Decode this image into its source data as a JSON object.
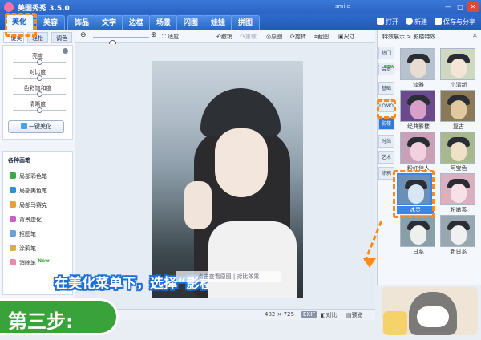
{
  "window": {
    "title": "美图秀秀 3.5.0",
    "user": "smile",
    "min": "—",
    "max": "□",
    "close": "✕"
  },
  "menu": {
    "tabs": [
      "美化",
      "美容",
      "饰品",
      "文字",
      "边框",
      "场景",
      "闪图",
      "娃娃",
      "拼图"
    ],
    "active": "美化",
    "open": "打开",
    "new": "新建",
    "save_share": "保存与分享"
  },
  "toolbar": {
    "fit": "适应",
    "undo": "撤销",
    "redo": "重做",
    "original": "原图",
    "rotate": "旋转",
    "crop": "截图",
    "size": "尺寸"
  },
  "left": {
    "sub_tabs": [
      "一键美化",
      "轻松",
      "调色"
    ],
    "sliders": [
      {
        "label": "亮度",
        "value": 0.5
      },
      {
        "label": "对比度",
        "value": 0.5
      },
      {
        "label": "色彩饱和度",
        "value": 0.5
      },
      {
        "label": "清晰度",
        "value": 0.5
      }
    ],
    "one_key": "一键美化",
    "brush_title": "各种画笔",
    "brushes": [
      {
        "label": "局部彩色笔",
        "color": "#3fa64a"
      },
      {
        "label": "局部美色笔",
        "color": "#2f8ed8"
      },
      {
        "label": "局部马赛克",
        "color": "#e2a23a"
      },
      {
        "label": "背景虚化",
        "color": "#c95ec7"
      },
      {
        "label": "抠图笔",
        "color": "#6aa0d8"
      },
      {
        "label": "涂鸦笔",
        "color": "#d8b23a"
      },
      {
        "label": "消除笔",
        "color": "#e88aa8",
        "badge": "New"
      }
    ]
  },
  "canvas": {
    "overlay_label": "点击查看原图 | 对比效果"
  },
  "status": {
    "size": "482 × 725",
    "exif": "EXIF",
    "compare": "对比",
    "preview": "预览"
  },
  "right": {
    "breadcrumb": "特效展示 > 影楼特效",
    "close": "✕",
    "categories": [
      {
        "label": "热门"
      },
      {
        "label": "会员",
        "badge": "NEW"
      },
      {
        "label": "基础"
      },
      {
        "label": "LOMO"
      },
      {
        "label": "影楼",
        "active": true
      },
      {
        "label": "时尚"
      },
      {
        "label": "艺术"
      },
      {
        "label": "涂鸦"
      }
    ],
    "effects": [
      {
        "label": "淡雅",
        "tint": "#b7c2cf",
        "face": "#e9ddd3"
      },
      {
        "label": "小清新",
        "tint": "#cfd8c0",
        "face": "#f3e6d8"
      },
      {
        "label": "经典影楼",
        "tint": "#6a4a8a",
        "face": "#d8a0c8"
      },
      {
        "label": "复古",
        "tint": "#8a7a5a",
        "face": "#e0c8a0"
      },
      {
        "label": "粉红佳人",
        "tint": "#c8a0b8",
        "face": "#f3d0e0"
      },
      {
        "label": "阿宝色",
        "tint": "#a8b890",
        "face": "#f0e0c8"
      },
      {
        "label": "冰灵",
        "tint": "#6c8fb8",
        "face": "#d8e6f3",
        "selected": true
      },
      {
        "label": "粉嫩系",
        "tint": "#d8b0c0",
        "face": "#f8e0e8"
      },
      {
        "label": "日系",
        "tint": "#8aa0a8",
        "face": "#eef0ee"
      },
      {
        "label": "新日系",
        "tint": "#98a8b0",
        "face": "#f0f0f0"
      }
    ]
  },
  "tutorial": {
    "instruction": "在美化菜单下，选择“影楼-冰灵”特效",
    "step": "第三步:"
  }
}
